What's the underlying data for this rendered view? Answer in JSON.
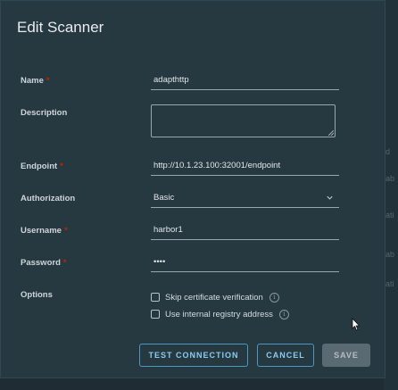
{
  "background": {
    "hints": [
      "d",
      "ab",
      "ati",
      "ati",
      "ab"
    ]
  },
  "dialog": {
    "title": "Edit Scanner",
    "required_marker": "*",
    "fields": {
      "name": {
        "label": "Name",
        "value": "adapthttp"
      },
      "description": {
        "label": "Description",
        "value": ""
      },
      "endpoint": {
        "label": "Endpoint",
        "value": "http://10.1.23.100:32001/endpoint"
      },
      "authorization": {
        "label": "Authorization",
        "value": "Basic"
      },
      "username": {
        "label": "Username",
        "value": "harbor1"
      },
      "password": {
        "label": "Password",
        "value": "••••"
      },
      "options": {
        "label": "Options",
        "skip_cert": "Skip certificate verification",
        "internal_registry": "Use internal registry address"
      }
    },
    "buttons": {
      "test_connection": "TEST CONNECTION",
      "cancel": "CANCEL",
      "save": "SAVE"
    }
  },
  "colors": {
    "accent": "#4a9ac4",
    "required": "#c92100",
    "modal_bg": "#263840"
  }
}
